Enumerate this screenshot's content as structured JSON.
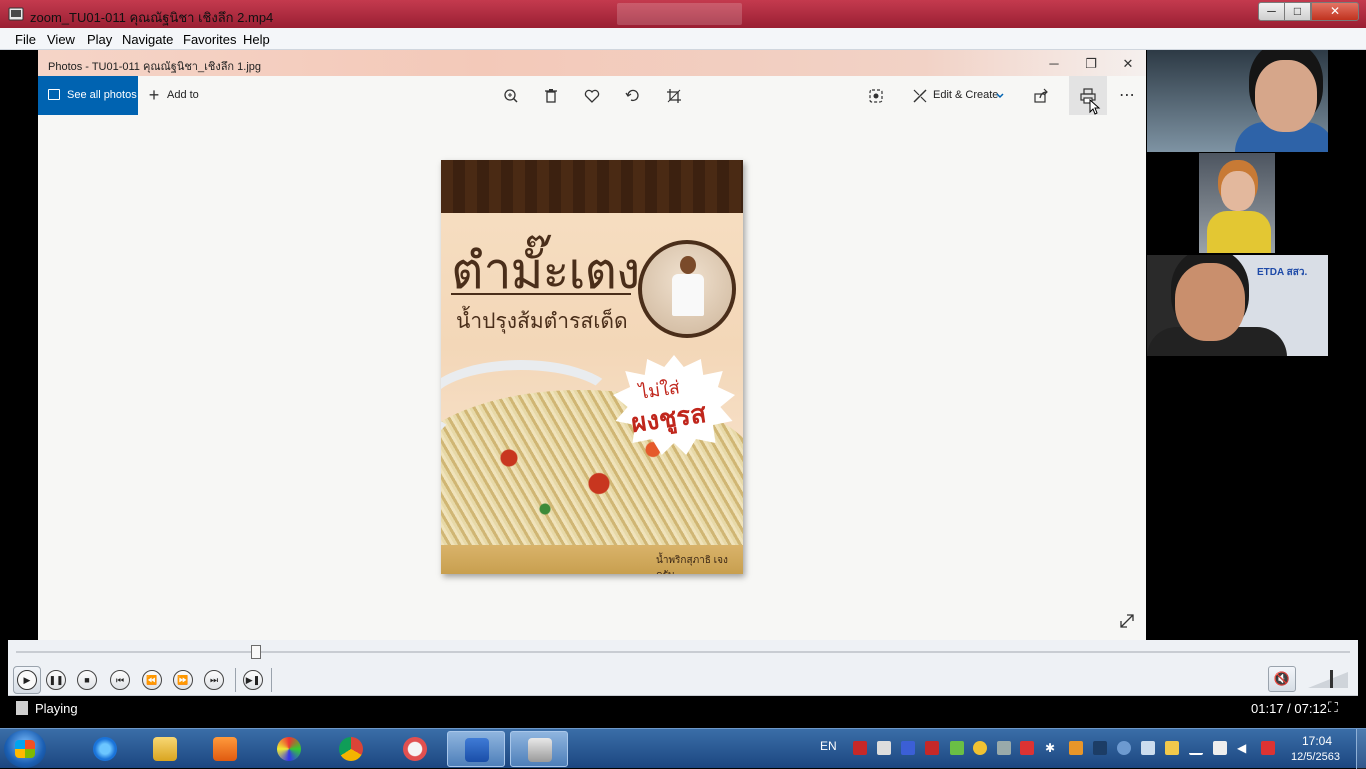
{
  "window": {
    "title": "zoom_TU01-011 คุณณัฐนิชา เชิงลึก 2.mp4",
    "controls": {
      "minimize": "─",
      "maximize": "□",
      "close": "✕"
    }
  },
  "menu": [
    "File",
    "View",
    "Play",
    "Navigate",
    "Favorites",
    "Help"
  ],
  "photos": {
    "title": "Photos - TU01-011 คุณณัฐนิชา_เชิงลึก 1.jpg",
    "see_all": "See all photos",
    "add_to": "Add to",
    "edit_create": "Edit & Create",
    "win_min": "─",
    "win_max": "❐",
    "win_close": "✕",
    "icons": [
      "zoom-icon",
      "delete-icon",
      "favorite-icon",
      "rotate-icon",
      "crop-icon",
      "enhance-icon",
      "share-icon",
      "print-icon",
      "more-icon",
      "expand-icon"
    ]
  },
  "poster": {
    "title": "ตำมั๊ะเตง",
    "subtitle": "น้ำปรุงส้มตำรสเด็ด",
    "badge_line1": "ไม่ใส่",
    "badge_line2": "ผงชูรส",
    "credit": "น้ำพริกสุภาธิ เจง ครับ"
  },
  "participants": [
    {
      "name": "participant-1"
    },
    {
      "name": "participant-2"
    },
    {
      "name": "participant-3",
      "sign_text": "ETDA สสว."
    }
  ],
  "player": {
    "state": "Playing",
    "time": "01:17 / 07:12",
    "progress": 0.18,
    "volume": 0.55,
    "muted": true
  },
  "taskbar": {
    "apps": [
      "internet-explorer",
      "file-explorer",
      "media-player",
      "paint",
      "chrome",
      "snipping-tool",
      "word",
      "media-player-classic"
    ],
    "language": "EN",
    "clock_time": "17:04",
    "clock_date": "12/5/2563"
  },
  "colors": {
    "titlebar": "#b02a3f",
    "photos_accent": "#0063b1",
    "taskbar": "#2a5b95"
  }
}
